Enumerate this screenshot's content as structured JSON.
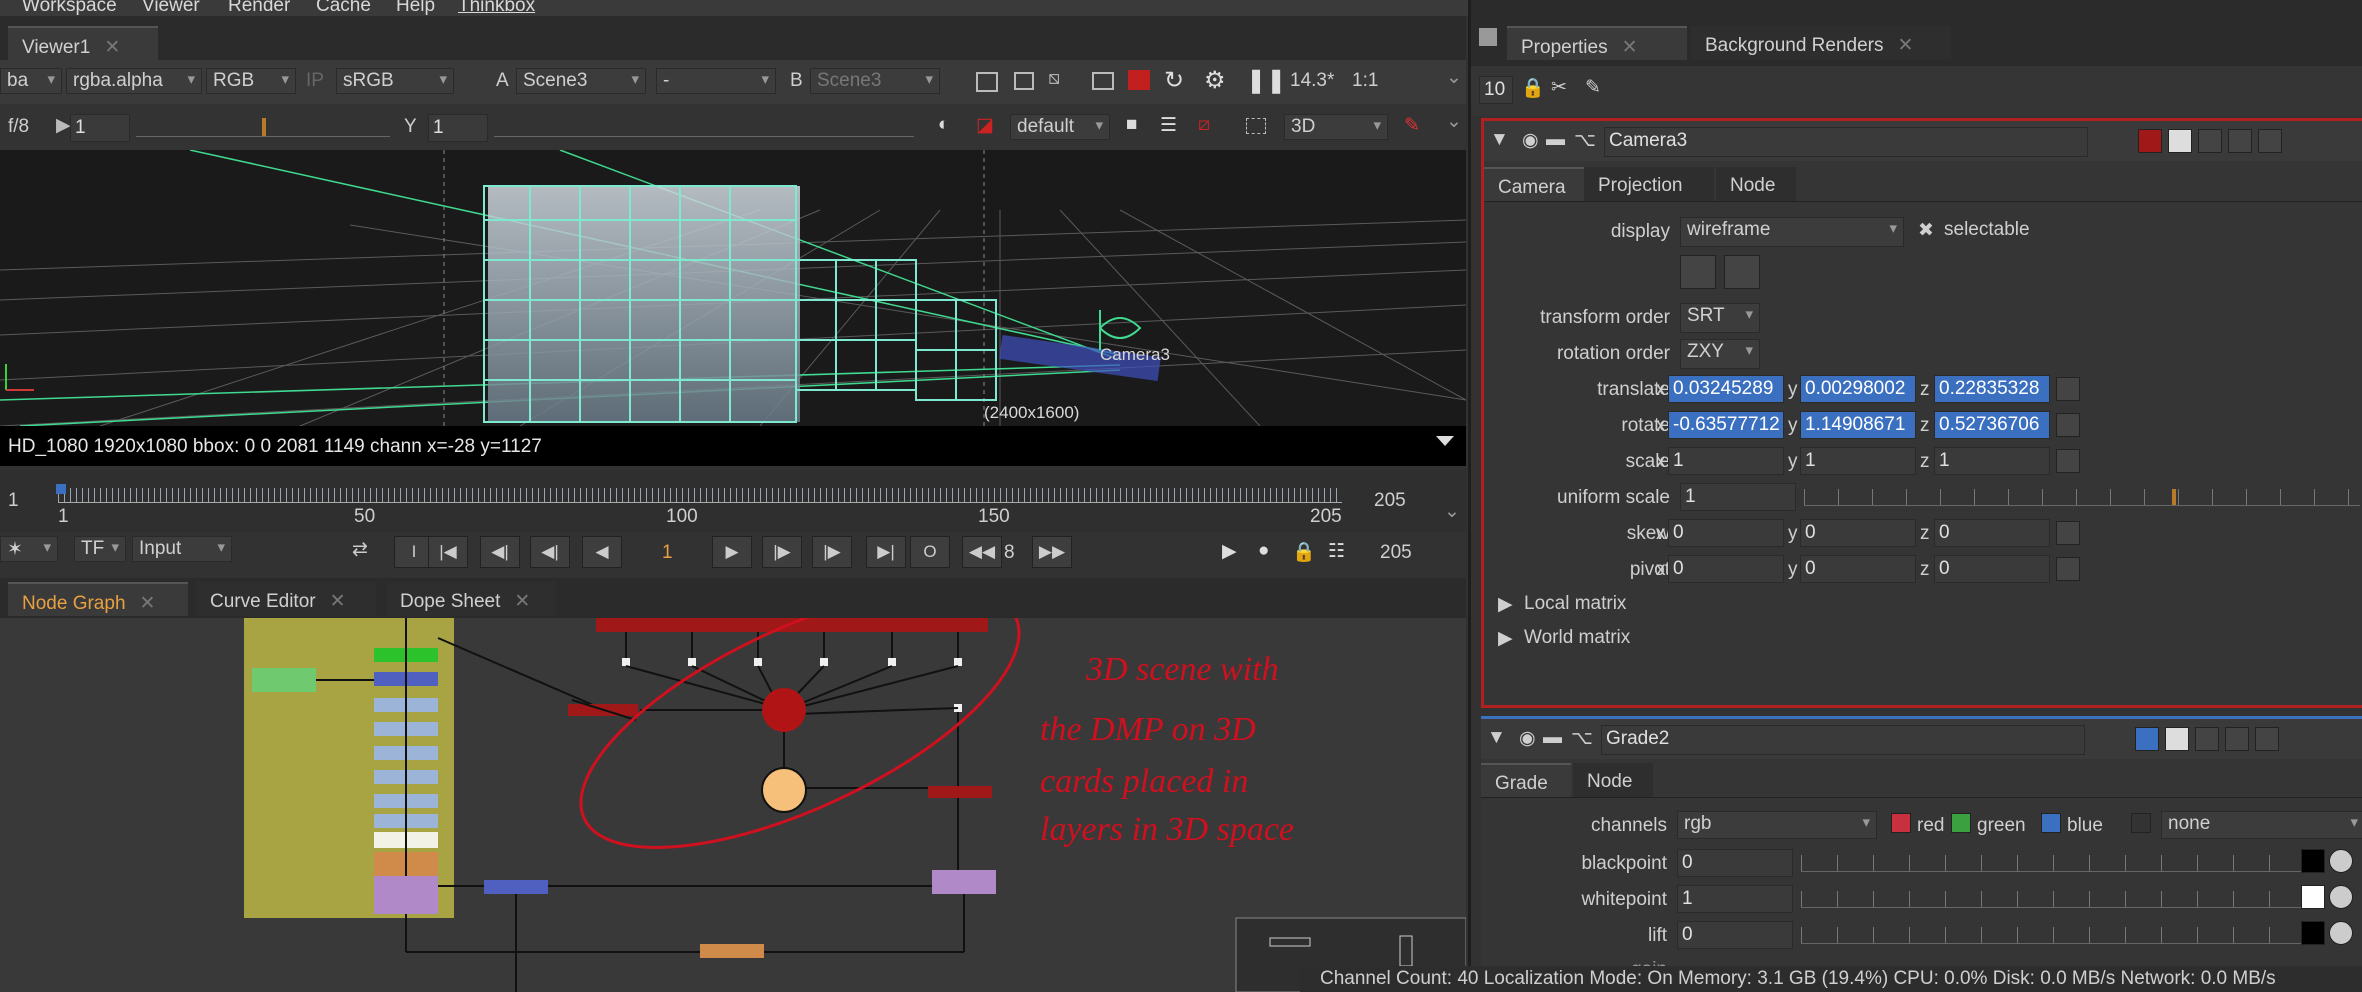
{
  "menu": [
    "Workspace",
    "Viewer",
    "Render",
    "Cache",
    "Help",
    "Thinkbox"
  ],
  "viewer": {
    "tab": "Viewer1",
    "close": "✕",
    "channel_set": "ba",
    "channel_alpha": "rgba.alpha",
    "display_channels": "RGB",
    "ip_label": "IP",
    "colorspace": "sRGB",
    "a_label": "A",
    "a_input": "Scene3",
    "a_op": "-",
    "b_label": "B",
    "b_input": "Scene3",
    "zoom": "14.3*",
    "ratio": "1:1",
    "fstop": "f/8",
    "gain": "1",
    "y_label": "Y",
    "gamma": "1",
    "lut": "default",
    "view_mode": "3D",
    "camera_label": "Camera3",
    "format_label": "(2400x1600)",
    "info_text": "HD_1080 1920x1080  bbox: 0 0 2081 1149 chann  x=-28 y=1127"
  },
  "timeline": {
    "start": "1",
    "end": "205",
    "ticks": [
      "1",
      "50",
      "100",
      "150",
      "205"
    ],
    "current_frame": "1",
    "step": "8",
    "end_frame": "205"
  },
  "playback": {
    "tf": "TF",
    "input": "Input",
    "i_btn": "I",
    "o_btn": "O"
  },
  "node_graph": {
    "tabs": [
      "Node Graph",
      "Curve Editor",
      "Dope Sheet"
    ],
    "annotation": [
      "3D scene with",
      "the DMP on 3D",
      "cards placed in",
      "layers in 3D space"
    ]
  },
  "properties": {
    "tabs": [
      "Properties",
      "Background Renders"
    ],
    "max_panels": "10",
    "camera": {
      "name": "Camera3",
      "subtabs": [
        "Camera",
        "Projection",
        "Node"
      ],
      "display_label": "display",
      "display_value": "wireframe",
      "selectable_label": "selectable",
      "transform_order_label": "transform order",
      "transform_order": "SRT",
      "rotation_order_label": "rotation order",
      "rotation_order": "ZXY",
      "translate_label": "translate",
      "translate": [
        "0.03245289",
        "0.00298002",
        "0.22835328"
      ],
      "rotate_label": "rotate",
      "rotate": [
        "-0.63577712",
        "1.14908671",
        "0.52736706"
      ],
      "scale_label": "scale",
      "scale": [
        "1",
        "1",
        "1"
      ],
      "uniform_scale_label": "uniform scale",
      "uniform_scale": "1",
      "skew_label": "skew",
      "skew": [
        "0",
        "0",
        "0"
      ],
      "pivot_label": "pivot",
      "pivot": [
        "0",
        "0",
        "0"
      ],
      "local_matrix": "Local matrix",
      "world_matrix": "World matrix",
      "axis": [
        "x",
        "y",
        "z"
      ]
    },
    "grade": {
      "name": "Grade2",
      "subtabs": [
        "Grade",
        "Node"
      ],
      "channels_label": "channels",
      "channels_value": "rgb",
      "red": "red",
      "green": "green",
      "blue": "blue",
      "none_value": "none",
      "blackpoint_label": "blackpoint",
      "blackpoint": "0",
      "whitepoint_label": "whitepoint",
      "whitepoint": "1",
      "lift_label": "lift",
      "lift": "0",
      "gain_label": "gain"
    }
  },
  "status": "Channel Count: 40  Localization Mode: On  Memory: 3.1 GB (19.4%)  CPU: 0.0%  Disk: 0.0 MB/s  Network: 0.0 MB/s",
  "colors": {
    "accent_blue": "#3b6fc0",
    "annotation_red": "#d0101e",
    "selected_outline": "#b02020"
  }
}
